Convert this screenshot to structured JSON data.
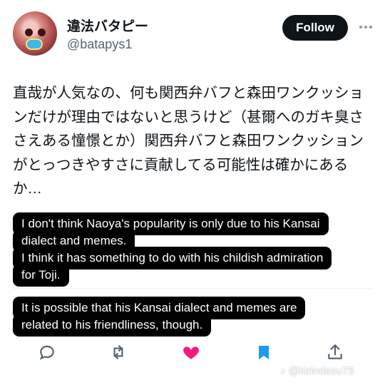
{
  "author": {
    "display_name": "違法バタピー",
    "handle": "@batapys1"
  },
  "follow_label": "Follow",
  "post_text": "直哉が人気なの、何も関西弁バフと森田ワンクッションだけが理由ではないと思うけど（甚爾へのガキ臭ささえある憧憬とか）関西弁バフと森田ワンクッションがとっつきやすさに貢献してる可能性は確かにあるか…",
  "subtitles": [
    "I don't think Naoya's popularity is only due to his Kansai",
    "dialect and memes.",
    "I think it has something to do with his childish admiration",
    "for Toji.",
    "It is possible that his Kansai dialect and memes are",
    "related to his friendliness, though."
  ],
  "actions": {
    "reply_icon": "reply-icon",
    "repost_icon": "repost-icon",
    "like_icon": "heart-icon",
    "bookmark_icon": "bookmark-icon",
    "share_icon": "share-icon",
    "like_color": "#f91880",
    "bookmark_color": "#1d9bf0",
    "neutral_color": "#536471"
  },
  "watermark": "@kirindesu75"
}
